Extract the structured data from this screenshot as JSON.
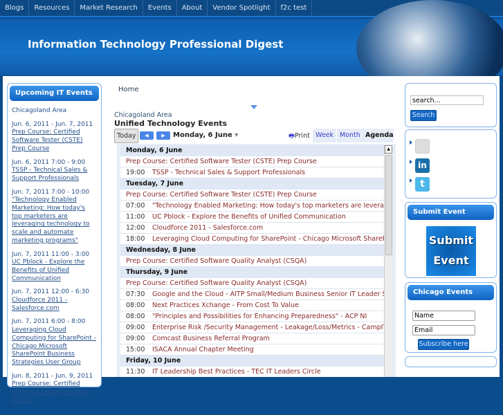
{
  "nav": [
    "Blogs",
    "Resources",
    "Market Research",
    "Events",
    "About",
    "Vendor Spotlight",
    "f2c test"
  ],
  "site_title": "Information Technology Professional Digest",
  "left": {
    "title": "Upcoming IT Events",
    "area": "Chicagoland Area",
    "events": [
      {
        "date": "Jun. 6, 2011 - Jun. 7, 2011",
        "title": "Prep Course: Certified Software Tester (CSTE) Prep Course"
      },
      {
        "date": "Jun. 6, 2011 7:00 - 9:00",
        "title": "TSSP - Technical Sales & Support Professionals"
      },
      {
        "date": "Jun. 7, 2011 7:00 - 10:00",
        "title": "\"Technology Enabled Marketing: How today's top marketers are leveraging technology to scale and automate marketing programs\""
      },
      {
        "date": "Jun. 7, 2011 11:00 - 3:00",
        "title": "UC Pblock - Explore the Benefits of Unified Communication"
      },
      {
        "date": "Jun. 7, 2011 12:00 - 6:30",
        "title": "Cloudforce 2011 - Salesforce.com"
      },
      {
        "date": "Jun. 7, 2011 6:00 - 8:00",
        "title": "Leveraging Cloud Computing for SharePoint - Chicago Microsoft SharePoint Business Strategies User Group"
      },
      {
        "date": "Jun. 8, 2011 - Jun. 9, 2011",
        "title": "Prep Course: Certified Software Quality Analyst (CSQA)"
      }
    ]
  },
  "breadcrumb": "Home",
  "calendar": {
    "area": "Chicagoland Area",
    "title": "Unified Technology Events",
    "today": "Today",
    "prev": "◀",
    "next": "▶",
    "date": "Monday, 6 June",
    "dropdown": "▾",
    "print": "Print",
    "views": [
      "Week",
      "Month",
      "Agenda"
    ],
    "days": [
      {
        "day": "Monday, 6 June",
        "events": [
          {
            "time": "",
            "title": "Prep Course: Certified Software Tester (CSTE) Prep Course"
          },
          {
            "time": "19:00",
            "title": "TSSP - Technical Sales & Support Professionals"
          }
        ]
      },
      {
        "day": "Tuesday, 7 June",
        "events": [
          {
            "time": "",
            "title": "Prep Course: Certified Software Tester (CSTE) Prep Course"
          },
          {
            "time": "07:00",
            "title": "\"Technology Enabled Marketing: How today's top marketers are leveraging"
          },
          {
            "time": "11:00",
            "title": "UC Pblock - Explore the Benefits of Unified Communication"
          },
          {
            "time": "12:00",
            "title": "Cloudforce 2011 - Salesforce.com"
          },
          {
            "time": "18:00",
            "title": "Leveraging Cloud Computing for SharePoint - Chicago Microsoft SharePoint"
          }
        ]
      },
      {
        "day": "Wednesday, 8 June",
        "events": [
          {
            "time": "",
            "title": "Prep Course: Certified Software Quality Analyst (CSQA)"
          }
        ]
      },
      {
        "day": "Thursday, 9 June",
        "events": [
          {
            "time": "",
            "title": "Prep Course: Certified Software Quality Analyst (CSQA)"
          },
          {
            "time": "07:30",
            "title": "Google and the Cloud - AITP Small/Medium Business Senior IT Leader SIG"
          },
          {
            "time": "08:00",
            "title": "Next Practices Xchange - From Cost To Value"
          },
          {
            "time": "08:00",
            "title": "\"Principles and Possibilities for Enhancing Preparedness\" - ACP NI"
          },
          {
            "time": "09:00",
            "title": "Enterprise Risk /Security Management - Leakage/Loss/Metrics - CampIT"
          },
          {
            "time": "09:00",
            "title": "Comcast Business Referral Program"
          },
          {
            "time": "15:00",
            "title": "ISACA Annual Chapter Meeting"
          }
        ]
      },
      {
        "day": "Friday, 10 June",
        "events": [
          {
            "time": "11:30",
            "title": "IT Leadership Best Practices - TEC IT Leaders Circle"
          }
        ]
      }
    ]
  },
  "search": {
    "value": "search...",
    "button": "Search"
  },
  "submit": {
    "title": "Submit Event",
    "image_text_1": "Submit",
    "image_text_2": "Event"
  },
  "chicago": {
    "title": "Chicago Events",
    "name": "Name",
    "email": "Email",
    "button": "Subscribe here"
  }
}
